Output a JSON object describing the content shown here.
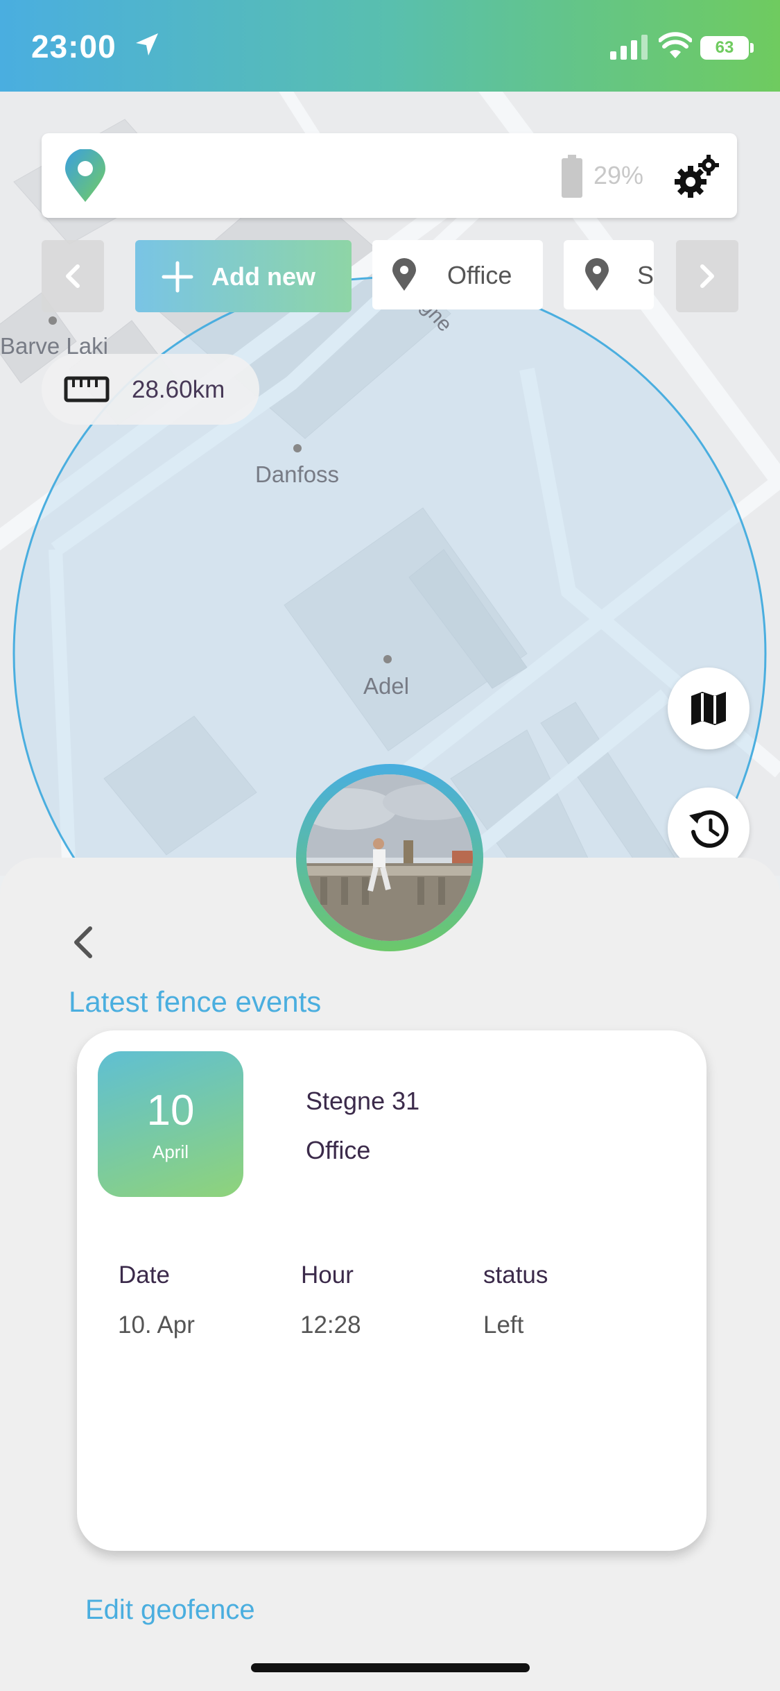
{
  "status_bar": {
    "time": "23:00",
    "battery": "63"
  },
  "top_bar": {
    "battery_percent": "29%"
  },
  "chips": {
    "add_new": "Add new",
    "office": "Office",
    "second": "Se"
  },
  "map": {
    "labels": [
      "Barve Laki",
      "Danfoss",
      "Adel",
      "egne"
    ],
    "distance": "28.60km"
  },
  "sheet": {
    "title": "Latest fence events",
    "event": {
      "day": "10",
      "month": "April",
      "address": "Stegne 31",
      "fence": "Office",
      "headers": [
        "Date",
        "Hour",
        "status"
      ],
      "values": [
        "10. Apr",
        "12:28",
        "Left"
      ]
    },
    "edit_link": "Edit geofence"
  },
  "colors": {
    "accent_blue": "#4aaedf",
    "accent_green": "#6fcb5f"
  },
  "icons": [
    "location-arrow-icon",
    "signal-icon",
    "wifi-icon",
    "app-logo-pin-icon",
    "device-battery-icon",
    "gear-icon",
    "chevron-left-icon",
    "plus-icon",
    "pin-icon",
    "chevron-right-icon",
    "ruler-icon",
    "map-icon",
    "history-icon",
    "back-chevron-icon"
  ]
}
